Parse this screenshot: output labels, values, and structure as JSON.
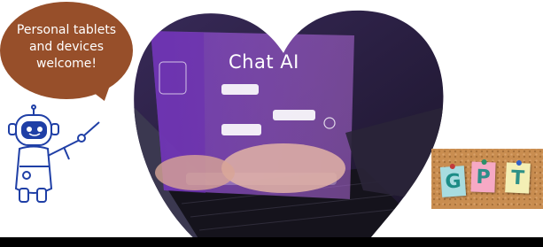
{
  "bubble": {
    "lines": [
      "Personal tablets",
      "and devices",
      "welcome!"
    ]
  },
  "photo": {
    "screen_title": "Chat AI"
  },
  "board": {
    "notes": [
      "G",
      "P",
      "T"
    ]
  },
  "colors": {
    "bubble": "#974f2a",
    "heart_purple": "#6b3fa8",
    "heart_dark": "#2a1e3e",
    "board": "#c98d50",
    "note_g": "#a8dce0",
    "note_p": "#f6a9c5",
    "note_t": "#f4efb5",
    "robot_outline": "#1f3fa6"
  },
  "icons": [
    "robot-icon",
    "pushpin-icon"
  ]
}
